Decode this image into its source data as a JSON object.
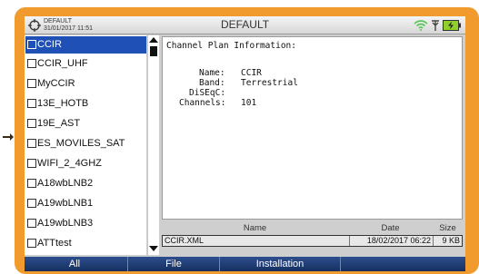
{
  "header": {
    "device": "DEFAULT",
    "datetime": "31/01/2017 11:51",
    "title": "DEFAULT"
  },
  "icons": {
    "logo": "settings-crosshair-icon",
    "wifi": "wifi-icon",
    "antenna": "antenna-icon",
    "battery": "battery-charging-icon"
  },
  "colors": {
    "frame": "#f19a2d",
    "selected": "#1f50b5",
    "bottom_bar": "#1f3d74",
    "battery": "#8fd02a",
    "wifi": "#5bc55b"
  },
  "list": {
    "selected_index": 0,
    "items": [
      {
        "label": "CCIR"
      },
      {
        "label": "CCIR_UHF"
      },
      {
        "label": "MyCCIR"
      },
      {
        "label": "13E_HOTB"
      },
      {
        "label": "19E_AST"
      },
      {
        "label": "ES_MOVILES_SAT"
      },
      {
        "label": "WIFI_2_4GHZ"
      },
      {
        "label": "A18wbLNB2"
      },
      {
        "label": "A19wbLNB1"
      },
      {
        "label": "A19wbLNB3"
      },
      {
        "label": "ATTtest"
      }
    ]
  },
  "info": {
    "heading": "Channel Plan Information:",
    "name_label": "Name:",
    "name_value": "CCIR",
    "band_label": "Band:",
    "band_value": "Terrestrial",
    "diseqc_label": "DiSEqC:",
    "diseqc_value": "",
    "channels_label": "Channels:",
    "channels_value": "101"
  },
  "file_table": {
    "headers": {
      "name": "Name",
      "date": "Date",
      "size": "Size"
    },
    "row": {
      "name": "CCIR.XML",
      "date": "18/02/2017 06:22",
      "size": "9 KB"
    }
  },
  "bottom_bar": {
    "tabs": [
      "All",
      "File",
      "Installation"
    ]
  }
}
